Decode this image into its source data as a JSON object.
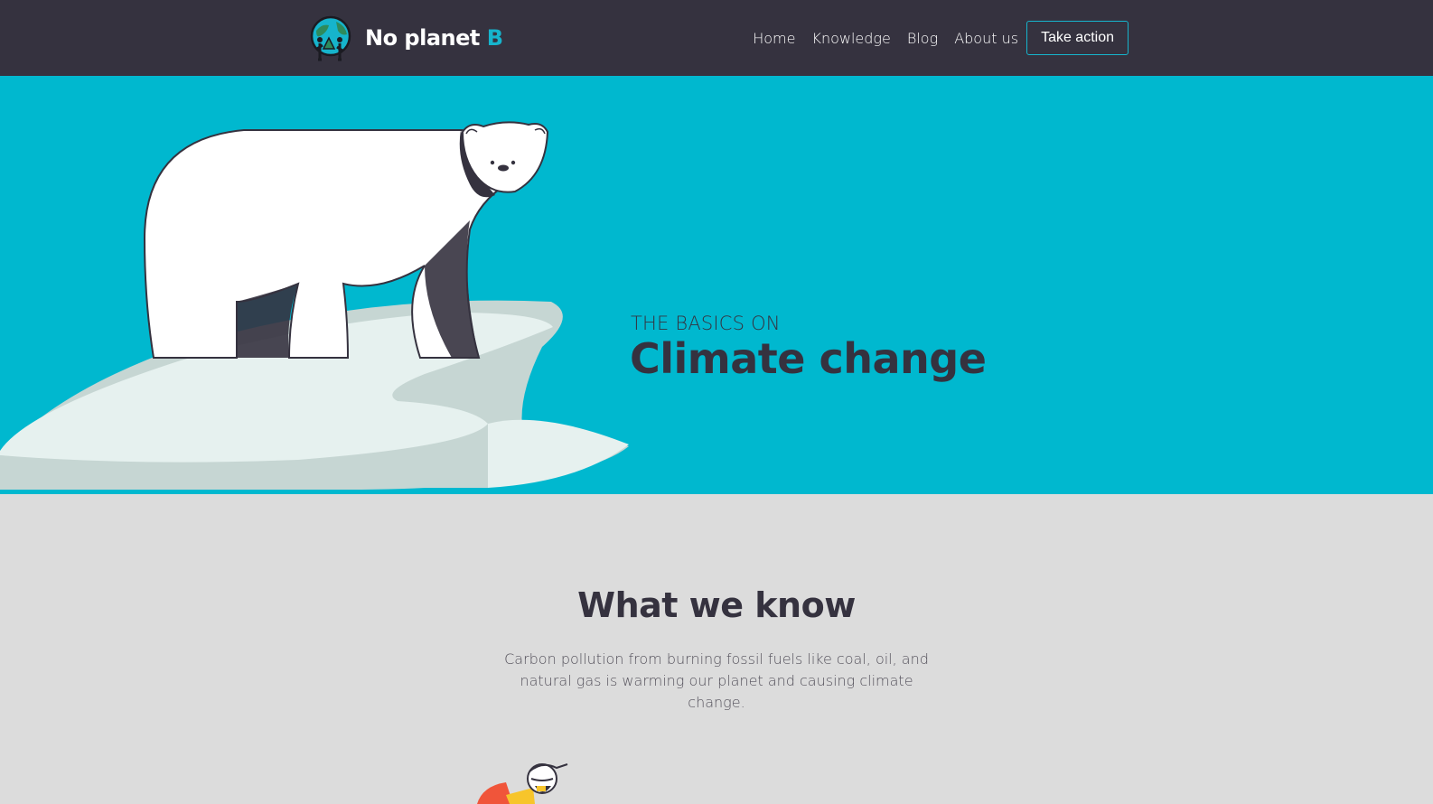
{
  "header": {
    "logo": {
      "icon": "globe-people-logo-icon",
      "name_main": "No planet",
      "name_accent": "B"
    },
    "nav": [
      {
        "label": "Home"
      },
      {
        "label": "Knowledge"
      },
      {
        "label": "Blog"
      },
      {
        "label": "About us"
      }
    ],
    "cta_label": "Take action"
  },
  "hero": {
    "kicker": "THE BASICS ON",
    "title": "Climate change",
    "illustration": "polar-bear-on-ice-floe"
  },
  "section": {
    "title": "What we know",
    "body": "Carbon pollution from burning fossil fuels like coal, oil, and natural gas is warming our planet and causing climate change.",
    "illustration": "character-illustration"
  },
  "colors": {
    "header_bg": "#35323f",
    "hero_bg": "#00b8cf",
    "accent": "#16b4cc",
    "page_bg": "#dcdcdc",
    "text_dark": "#35323f"
  }
}
